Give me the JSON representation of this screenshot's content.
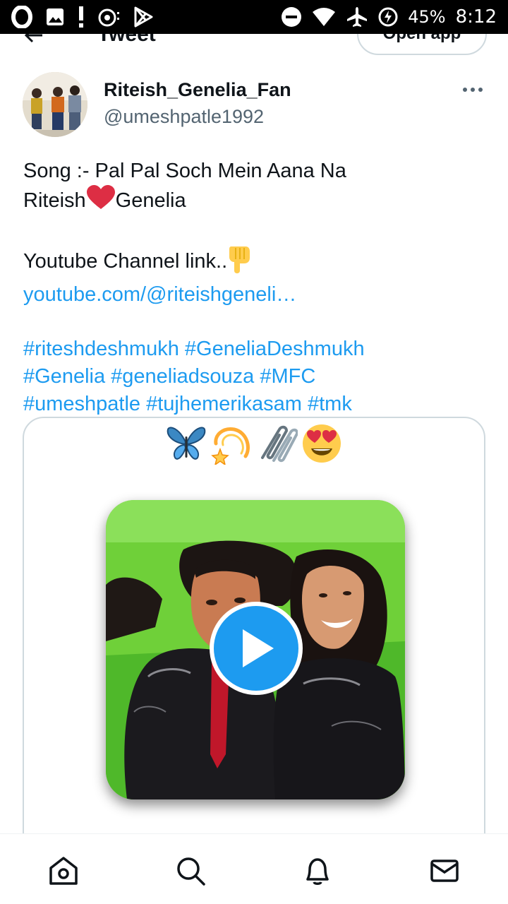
{
  "status_bar": {
    "battery_percent": "45%",
    "time": "8:12",
    "icons": [
      "opera-icon",
      "image-icon",
      "alert-icon",
      "podcast-icon",
      "play-store-icon",
      "do-not-disturb-icon",
      "wifi-icon",
      "airplane-icon",
      "battery-charging-icon"
    ]
  },
  "header": {
    "title": "Tweet",
    "open_app_label": "Open app",
    "back_icon": "back-arrow-icon"
  },
  "tweet": {
    "display_name": "Riteish_Genelia_Fan",
    "handle": "@umeshpatle1992",
    "lines": {
      "song": "Song :- Pal Pal Soch Mein Aana Na",
      "name_a": "Riteish",
      "name_b": "Genelia",
      "yt_label": "Youtube Channel link..",
      "yt_link": "youtube.com/@riteishgeneli…",
      "hashtags_1": "#riteshdeshmukh #GeneliaDeshmukh",
      "hashtags_2": "#Genelia #geneliadsouza #MFC",
      "hashtags_3": "#umeshpatle #tujhemerikasam #tmk"
    }
  },
  "media": {
    "emojis": [
      "butterfly",
      "dizzy",
      "paperclips",
      "heart-eyes"
    ],
    "play_icon": "play-icon"
  },
  "bottom_nav": {
    "items": [
      "home-icon",
      "search-icon",
      "notifications-icon",
      "messages-icon"
    ]
  },
  "colors": {
    "link": "#1d9bf0",
    "text": "#0f1419",
    "secondary": "#536471",
    "border": "#cfd9de"
  }
}
